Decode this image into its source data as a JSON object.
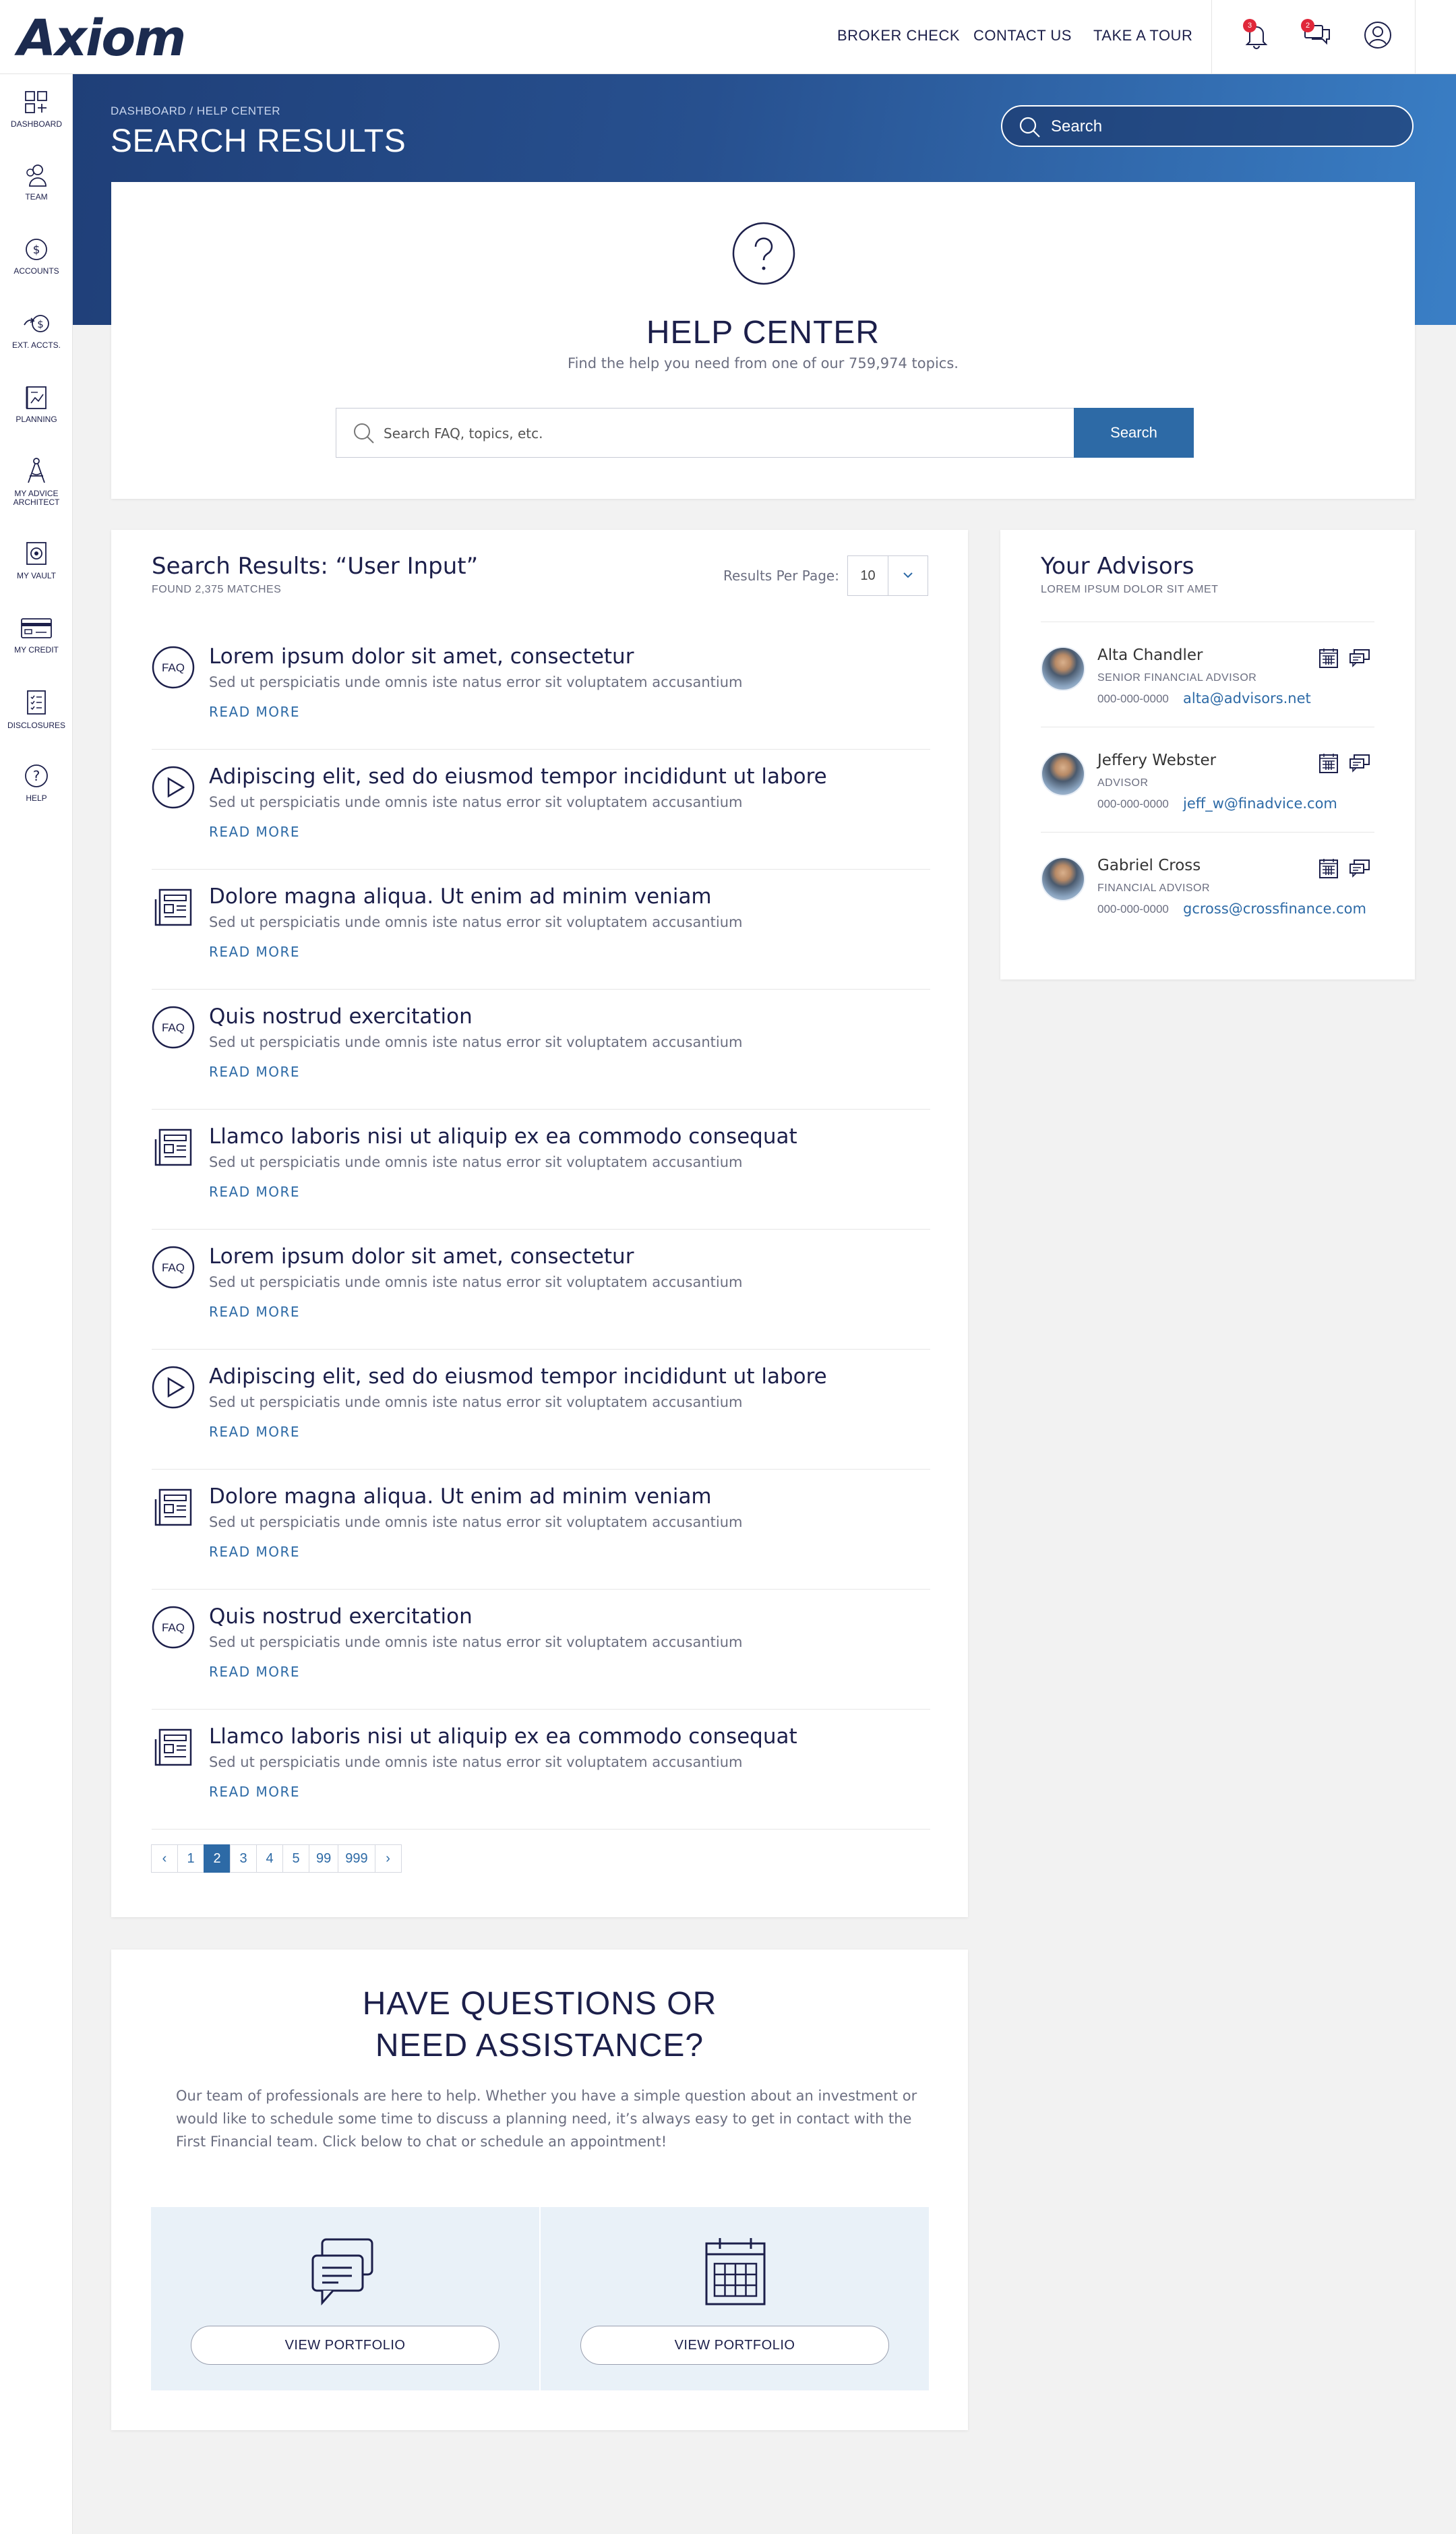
{
  "app": {
    "logo": "Axiom"
  },
  "topnav": {
    "broker_check": "BROKER CHECK",
    "contact_us": "CONTACT US",
    "take_tour": "TAKE A TOUR"
  },
  "notifications": {
    "bell_count": "3",
    "messages_count": "2"
  },
  "sidebar": {
    "items": [
      {
        "label": "DASHBOARD",
        "icon": "dashboard-icon"
      },
      {
        "label": "TEAM",
        "icon": "team-icon"
      },
      {
        "label": "ACCOUNTS",
        "icon": "accounts-icon"
      },
      {
        "label": "EXT. ACCTS.",
        "icon": "external-accounts-icon"
      },
      {
        "label": "PLANNING",
        "icon": "planning-icon"
      },
      {
        "label": "MY ADVICE ARCHITECT",
        "icon": "advice-architect-icon"
      },
      {
        "label": "MY VAULT",
        "icon": "vault-icon"
      },
      {
        "label": "MY CREDIT",
        "icon": "credit-card-icon"
      },
      {
        "label": "DISCLOSURES",
        "icon": "disclosures-icon"
      },
      {
        "label": "HELP",
        "icon": "help-icon"
      }
    ]
  },
  "hero": {
    "breadcrumb": "DASHBOARD  / HELP CENTER",
    "title": "SEARCH RESULTS",
    "search_placeholder": "Search"
  },
  "help_center": {
    "title": "HELP CENTER",
    "subtitle": "Find the help you need from one of our 759,974 topics.",
    "search_placeholder": "Search FAQ, topics, etc.",
    "search_button": "Search"
  },
  "results": {
    "title": "Search Results: “User Input”",
    "count": "FOUND 2,375 MATCHES",
    "per_page_label": "Results Per Page:",
    "per_page_value": "10",
    "read_more": "READ MORE",
    "items": [
      {
        "type": "faq",
        "title": "Lorem ipsum dolor sit amet, consectetur",
        "desc": "Sed ut perspiciatis unde omnis iste natus error sit voluptatem accusantium"
      },
      {
        "type": "video",
        "title": "Adipiscing elit, sed do eiusmod tempor incididunt ut labore",
        "desc": "Sed ut perspiciatis unde omnis iste natus error sit voluptatem accusantium"
      },
      {
        "type": "article",
        "title": "Dolore magna aliqua. Ut enim ad minim veniam",
        "desc": "Sed ut perspiciatis unde omnis iste natus error sit voluptatem accusantium"
      },
      {
        "type": "faq",
        "title": "Quis nostrud exercitation",
        "desc": "Sed ut perspiciatis unde omnis iste natus error sit voluptatem accusantium"
      },
      {
        "type": "article",
        "title": "Llamco laboris nisi ut aliquip ex ea commodo consequat",
        "desc": "Sed ut perspiciatis unde omnis iste natus error sit voluptatem accusantium"
      },
      {
        "type": "faq",
        "title": "Lorem ipsum dolor sit amet, consectetur",
        "desc": "Sed ut perspiciatis unde omnis iste natus error sit voluptatem accusantium"
      },
      {
        "type": "video",
        "title": "Adipiscing elit, sed do eiusmod tempor incididunt ut labore",
        "desc": "Sed ut perspiciatis unde omnis iste natus error sit voluptatem accusantium"
      },
      {
        "type": "article",
        "title": "Dolore magna aliqua. Ut enim ad minim veniam",
        "desc": "Sed ut perspiciatis unde omnis iste natus error sit voluptatem accusantium"
      },
      {
        "type": "faq",
        "title": "Quis nostrud exercitation",
        "desc": "Sed ut perspiciatis unde omnis iste natus error sit voluptatem accusantium"
      },
      {
        "type": "article",
        "title": "Llamco laboris nisi ut aliquip ex ea commodo consequat",
        "desc": "Sed ut perspiciatis unde omnis iste natus error sit voluptatem accusantium"
      }
    ],
    "faq_label": "FAQ",
    "pagination": {
      "pages": [
        "1",
        "2",
        "3",
        "4",
        "5",
        "99",
        "999"
      ],
      "current": "2",
      "prev": "‹",
      "next": "›"
    }
  },
  "advisors": {
    "title": "Your Advisors",
    "subtitle": "LOREM IPSUM DOLOR SIT AMET",
    "items": [
      {
        "name": "Alta Chandler",
        "role": "SENIOR FINANCIAL ADVISOR",
        "phone": "000-000-0000",
        "email": "alta@advisors.net"
      },
      {
        "name": "Jeffery Webster",
        "role": "ADVISOR",
        "phone": "000-000-0000",
        "email": "jeff_w@finadvice.com"
      },
      {
        "name": "Gabriel Cross",
        "role": "FINANCIAL ADVISOR",
        "phone": "000-000-0000",
        "email": "gcross@crossfinance.com"
      }
    ]
  },
  "questions": {
    "title_line1": "HAVE QUESTIONS OR",
    "title_line2": "NEED ASSISTANCE?",
    "text": "Our team of professionals are here to help. Whether you have a simple question about an investment or would like to schedule some time to discuss a planning need, it’s always easy to get in contact with the First Financial team. Click below to chat or schedule an appointment!",
    "chat_button": "VIEW PORTFOLIO",
    "schedule_button": "VIEW PORTFOLIO"
  },
  "colors": {
    "primary": "#2d6aa6",
    "navy": "#1c1f4a",
    "hero_start": "#1f3f78",
    "hero_end": "#3a7fc6",
    "badge": "#e0283a"
  }
}
